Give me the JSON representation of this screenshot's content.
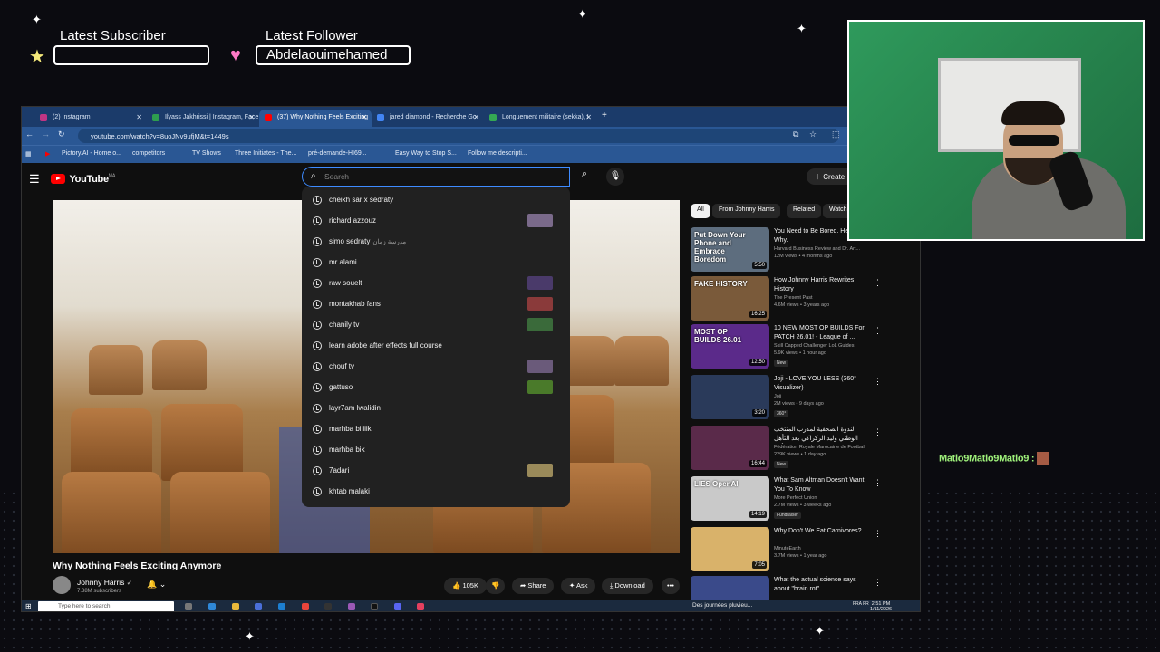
{
  "overlay": {
    "latest_subscriber_label": "Latest Subscriber",
    "latest_subscriber_value": "",
    "latest_follower_label": "Latest Follower",
    "latest_follower_value": "Abdelaouimehamed",
    "chat_line": "Matlo9Matlo9Matlo9 :"
  },
  "browser": {
    "tabs": [
      {
        "label": "(2) Instagram",
        "color": "#c13584"
      },
      {
        "label": "Ilyass Jakhrissi | Instagram, Face",
        "color": "#2e9e4f"
      },
      {
        "label": "(37) Why Nothing Feels Exciting",
        "color": "#ff0000",
        "active": true
      },
      {
        "label": "jared diamond - Recherche Go",
        "color": "#4285f4"
      },
      {
        "label": "Longuement militaire (sekka), I",
        "color": "#34a853"
      }
    ],
    "new_tab": "+",
    "url": "youtube.com/watch?v=8uoJNv9ufjM&t=1449s",
    "bookmarks": [
      "Pictory.AI - Home o...",
      "competitors",
      "TV Shows",
      "Three Initiates - The...",
      "pré-demande-HI69...",
      "Easy Way to Stop S...",
      "Follow me descripti..."
    ]
  },
  "youtube": {
    "logo_text": "YouTube",
    "logo_country": "MA",
    "search_placeholder": "Search",
    "create_label": "Create",
    "suggestions": [
      {
        "text": "cheikh sar x sedraty",
        "extra": "",
        "thumb": ""
      },
      {
        "text": "richard azzouz",
        "extra": "",
        "thumb": "#7a6a8a"
      },
      {
        "text": "simo sedraty",
        "extra": "مدرسة زمان",
        "thumb": ""
      },
      {
        "text": "mr alami",
        "extra": "",
        "thumb": ""
      },
      {
        "text": "raw souelt",
        "extra": "",
        "thumb": "#4a3a6a"
      },
      {
        "text": "montakhab fans",
        "extra": "",
        "thumb": "#8a3a3a"
      },
      {
        "text": "chanily tv",
        "extra": "",
        "thumb": "#3a6a3a"
      },
      {
        "text": "learn adobe after effects full course",
        "extra": "",
        "thumb": ""
      },
      {
        "text": "chouf tv",
        "extra": "",
        "thumb": "#6a5a7a"
      },
      {
        "text": "gattuso",
        "extra": "",
        "thumb": "#4a7a2a"
      },
      {
        "text": "layr7am lwalidin",
        "extra": "",
        "thumb": ""
      },
      {
        "text": "marhba biiiiik",
        "extra": "",
        "thumb": ""
      },
      {
        "text": "marhba bik",
        "extra": "",
        "thumb": ""
      },
      {
        "text": "7adari",
        "extra": "",
        "thumb": "#9a8a5a"
      },
      {
        "text": "khtab malaki",
        "extra": "",
        "thumb": ""
      }
    ],
    "video": {
      "title": "Why Nothing Feels Exciting Anymore",
      "channel": "Johnny Harris",
      "subscribers": "7.38M subscribers",
      "likes": "105K",
      "share": "Share",
      "ask": "Ask",
      "download": "Download"
    },
    "chips": [
      "All",
      "From Johnny Harris",
      "Related",
      "Watch"
    ],
    "recommendations": [
      {
        "title": "You Need to Be Bored. Here's Why.",
        "channel": "Harvard Business Review and Dr. Art...",
        "meta": "12M views • 4 months ago",
        "badge": "",
        "duration": "5:50",
        "thumb_text": "Put Down Your Phone and Embrace Boredom",
        "thumb_color": "#5d6d7e"
      },
      {
        "title": "How Johnny Harris Rewrites History",
        "channel": "The Present Past",
        "meta": "4.6M views • 3 years ago",
        "badge": "",
        "duration": "16:25",
        "thumb_text": "FAKE HISTORY",
        "thumb_color": "#7a5a3a"
      },
      {
        "title": "10 NEW MOST OP BUILDS For PATCH 26.01! - League of ...",
        "channel": "Skill Capped Challenger LoL Guides",
        "meta": "5.9K views • 1 hour ago",
        "badge": "New",
        "duration": "12:50",
        "thumb_text": "MOST OP BUILDS 26.01",
        "thumb_color": "#5b2a8a"
      },
      {
        "title": "Joji - LOVE YOU LESS (360° Visualizer)",
        "channel": "Joji",
        "meta": "2M views • 9 days ago",
        "badge": "360°",
        "duration": "3:20",
        "thumb_text": "",
        "thumb_color": "#2a3a5a"
      },
      {
        "title": "الندوة الصحفية لمدرب المنتخب الوطني وليد الركراكي بعد التأهل لنصف نهائي كأس",
        "channel": "Fédération Royale Marocaine de Football",
        "meta": "229K views • 1 day ago",
        "badge": "New",
        "duration": "16:44",
        "thumb_text": "",
        "thumb_color": "#5a2a4a"
      },
      {
        "title": "What Sam Altman Doesn't Want You To Know",
        "channel": "More Perfect Union",
        "meta": "2.7M views • 3 weeks ago",
        "badge": "Fundraiser",
        "duration": "14:19",
        "thumb_text": "LIES OpenAI",
        "thumb_color": "#c9c9c9"
      },
      {
        "title": "Why Don't We Eat Carnivores?",
        "channel": "MinuteEarth",
        "meta": "3.7M views • 1 year ago",
        "badge": "",
        "duration": "7:05",
        "thumb_text": "",
        "thumb_color": "#d9b26a"
      },
      {
        "title": "What the actual science says about \"brain rot\"",
        "channel": "",
        "meta": "",
        "badge": "",
        "duration": "",
        "thumb_text": "",
        "thumb_color": "#3a4a8a"
      }
    ]
  },
  "taskbar": {
    "search_placeholder": "Type here to search",
    "weather": "Des journées pluvieu...",
    "lang": "FRA FR",
    "time": "2:51 PM",
    "date": "1/11/2026"
  }
}
